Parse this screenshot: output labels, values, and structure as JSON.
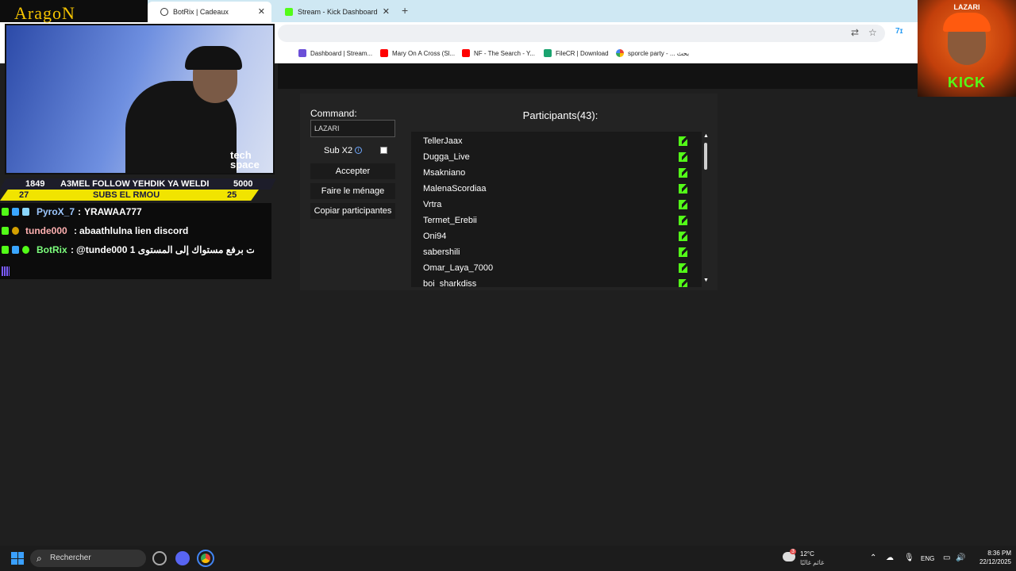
{
  "browser": {
    "tabs": [
      {
        "label": "BotRix | Cadeaux",
        "active": true
      },
      {
        "label": "Stream - Kick Dashboard",
        "active": false
      }
    ],
    "bookmarks": [
      {
        "label": "Dashboard | Stream..."
      },
      {
        "label": "Mary On A Cross (Sl..."
      },
      {
        "label": "NF - The Search - Y..."
      },
      {
        "label": "FileCR | Download"
      },
      {
        "label": "sporcle party - ... بحث"
      }
    ]
  },
  "form": {
    "command_label": "Command:",
    "command_value": "LAZARI",
    "sub_label": "Sub X2",
    "sub_checked": false,
    "accept_label": "Accepter",
    "clean_label": "Faire le ménage",
    "copy_label": "Copiar participantes"
  },
  "participants": {
    "title": "Participants(43):",
    "names": [
      "TellerJaax",
      "Dugga_Live",
      "Msakniano",
      "MalenaScordiaa",
      "Vrtra",
      "Termet_Erebii",
      "Oni94",
      "sabershili",
      "Omar_Laya_7000",
      "boi_sharkdiss"
    ]
  },
  "overlay": {
    "brand": "AragoN",
    "banner_left_top": "1849",
    "banner_text": "A3MEL FOLLOW YEHDIK YA WELDI",
    "banner_right_top": "5000",
    "banner_left_bottom": "27",
    "banner_sub_text": "SUBS EL RMOU",
    "banner_right_bottom": "25",
    "webcam_logo": "tech space",
    "chat": [
      {
        "user": "PyroX_7",
        "message": "YRAWAA777",
        "color": "#9ec8ff"
      },
      {
        "user": "tunde000",
        "message": "abaathlulna lien discord",
        "color": "#ffb0b0"
      },
      {
        "user": "BotRix",
        "message": "@tunde000 1 قمت برفع مستواك إلى المستوى",
        "color": "#7dff7d"
      }
    ],
    "promo_name": "LAZARI",
    "promo_kick": "KICK"
  },
  "taskbar": {
    "search_placeholder": "Rechercher",
    "weather_temp": "12°C",
    "weather_desc": "غائم غالبًا",
    "weather_badge": "3",
    "language": "ENG",
    "time": "8:36 PM",
    "date": "22/12/2025"
  }
}
